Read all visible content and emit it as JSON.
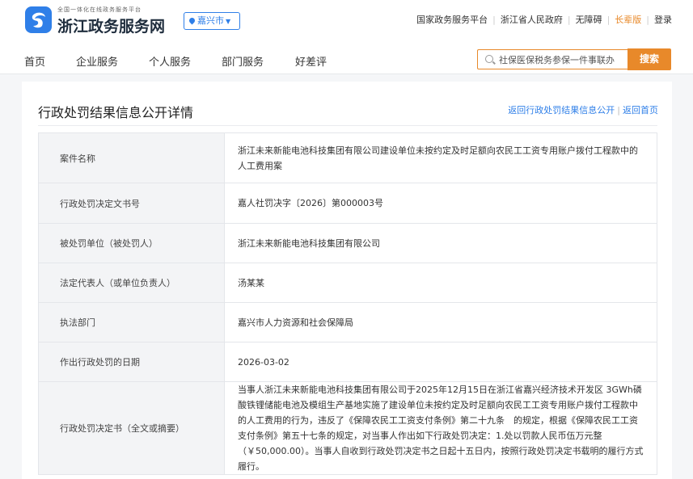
{
  "header": {
    "brand_tagline": "全国一体化在线政务服务平台",
    "brand_name": "浙江政务服务网",
    "city": "嘉兴市",
    "top_links": [
      "国家政务服务平台",
      "浙江省人民政府",
      "无障碍",
      "长辈版",
      "登录"
    ]
  },
  "nav": {
    "items": [
      "首页",
      "企业服务",
      "个人服务",
      "部门服务",
      "好差评"
    ]
  },
  "search": {
    "placeholder": "社保医保税务参保一件事联办",
    "button": "搜索"
  },
  "page": {
    "title": "行政处罚结果信息公开详情",
    "link_back_list": "返回行政处罚结果信息公开",
    "link_sep": "|",
    "link_back_home": "返回首页"
  },
  "details": [
    {
      "label": "案件名称",
      "value": "浙江未来新能电池科技集团有限公司建设单位未按约定及时足额向农民工工资专用账户拨付工程款中的人工费用案"
    },
    {
      "label": "行政处罚决定文书号",
      "value": "嘉人社罚决字〔2026〕第000003号"
    },
    {
      "label": "被处罚单位（被处罚人）",
      "value": "浙江未来新能电池科技集团有限公司"
    },
    {
      "label": "法定代表人（或单位负责人）",
      "value": "汤某某"
    },
    {
      "label": "执法部门",
      "value": "嘉兴市人力资源和社会保障局"
    },
    {
      "label": "作出行政处罚的日期",
      "value": "2026-03-02"
    },
    {
      "label": "行政处罚决定书（全文或摘要）",
      "value": "当事人浙江未来新能电池科技集团有限公司于2025年12月15日在浙江省嘉兴经济技术开发区 3GWh磷酸铁锂储能电池及模组生产基地实施了建设单位未按约定及时足额向农民工工资专用账户拨付工程款中的人工费用的行为，违反了《保障农民工工资支付条例》第二十九条　的规定，根据《保障农民工工资支付条例》第五十七条的规定，对当事人作出如下行政处罚决定：1.处以罚款人民币伍万元整（￥50,000.00）。当事人自收到行政处罚决定书之日起十五日内，按照行政处罚决定书载明的履行方式履行。"
    }
  ],
  "colors": {
    "accent": "#2f7fe8",
    "search_accent": "#e8892a"
  }
}
